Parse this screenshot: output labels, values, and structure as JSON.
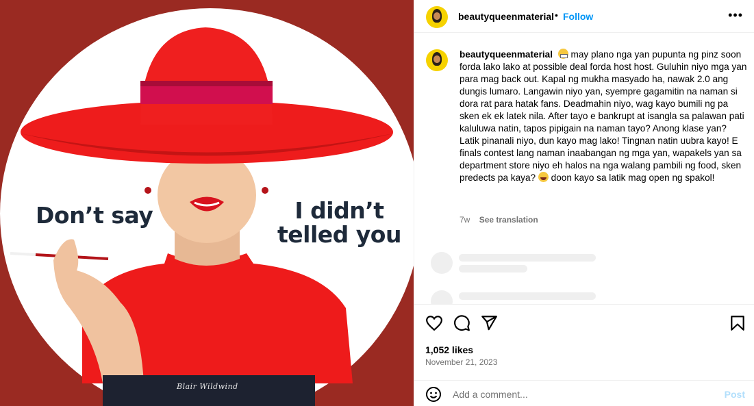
{
  "post": {
    "username": "beautyqueenmaterial",
    "dot": "•",
    "follow_label": "Follow",
    "more_label": "•••"
  },
  "image": {
    "quote_left": "Don’t say",
    "quote_right_line1": "I didn’t",
    "quote_right_line2": "telled you",
    "signature": "Blair Wildwind"
  },
  "caption": {
    "username": "beautyqueenmaterial",
    "text_part1": " may plano nga yan pupunta ng pinz soon forda lako lako at possible deal forda host host. Guluhin niyo mga yan para mag back out. Kapal ng mukha masyado ha, nawak 2.0 ang dungis lumaro. Langawin niyo yan, syempre gagamitin na naman si dora rat para hatak fans. Deadmahin niyo, wag kayo bumili ng pa sken ek ek latek nila. After tayo e bankrupt at isangla sa palawan pati kaluluwa natin, tapos pipigain na naman tayo? Anong klase yan? Latik pinanali niyo, dun kayo mag lako! Tingnan natin uubra kayo! E finals contest lang naman inaabangan ng mga yan, wapakels yan sa department store niyo eh halos na nga walang pambili ng food, sken predects pa kaya? ",
    "text_part2": " doon kayo sa latik mag open ng spakol!",
    "emoji1": "grimacing-face",
    "emoji2": "tears-of-joy-face",
    "time": "7w",
    "see_translation": "See translation"
  },
  "stats": {
    "likes": "1,052 likes",
    "date": "November 21, 2023"
  },
  "comment": {
    "placeholder": "Add a comment...",
    "post_label": "Post"
  },
  "colors": {
    "background_red": "#9a2a22",
    "hat_red": "#ee1c1c",
    "follow_blue": "#0095f6",
    "post_disabled": "#b2dffc"
  }
}
